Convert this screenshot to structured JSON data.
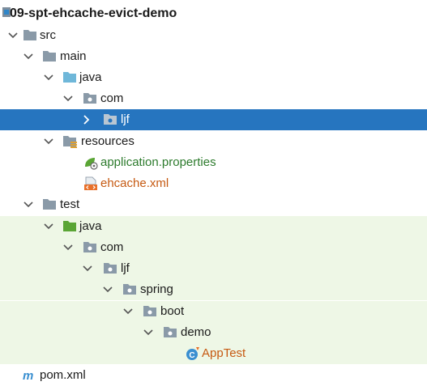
{
  "project": {
    "name": "09-spt-ehcache-evict-demo"
  },
  "nodes": {
    "src": "src",
    "main": "main",
    "main_java": "java",
    "main_com": "com",
    "ljf_selected": "ljf",
    "resources": "resources",
    "app_props": "application.properties",
    "ehcache": "ehcache.xml",
    "test": "test",
    "test_java": "java",
    "test_com": "com",
    "test_ljf": "ljf",
    "spring": "spring",
    "boot": "boot",
    "demo": "demo",
    "apptest": "AppTest",
    "pom": "pom.xml"
  },
  "colors": {
    "selection": "#2675bf",
    "test_bg": "#eef7e6",
    "folder": "#8a9aa8",
    "java_folder": "#6fb7d9",
    "test_folder": "#5aa535",
    "package": "#8a9aa8",
    "green_text": "#2d7b2d",
    "orange_text": "#c65a12"
  },
  "icons": {
    "folder": "folder-icon",
    "source_root": "source-root-icon",
    "test_root": "test-root-icon",
    "package": "package-icon",
    "resources": "resources-root-icon",
    "properties": "properties-file-icon",
    "xml": "xml-file-icon",
    "class": "class-icon",
    "maven": "maven-icon",
    "module": "module-icon"
  }
}
